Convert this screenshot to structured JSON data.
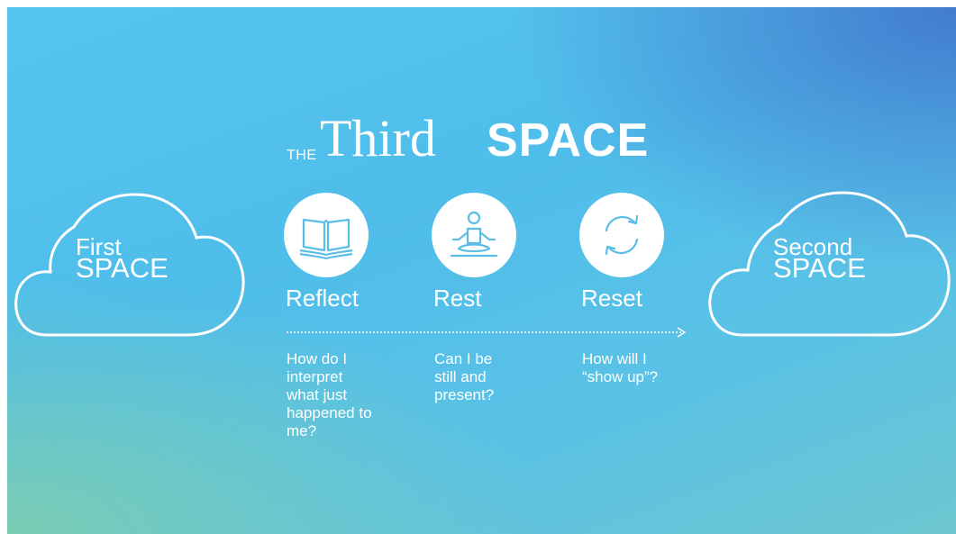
{
  "title": {
    "the": "THE",
    "third": "Third",
    "space": "SPACE"
  },
  "clouds": {
    "first": {
      "line1": "First",
      "line2": "SPACE"
    },
    "second": {
      "line1": "Second",
      "line2": "SPACE"
    }
  },
  "steps": [
    {
      "label": "Reflect",
      "icon": "open-book-icon",
      "question": "How do I\ninterpret\nwhat just\nhappened to\nme?"
    },
    {
      "label": "Rest",
      "icon": "meditation-icon",
      "question": "Can I be\nstill and\npresent?"
    },
    {
      "label": "Reset",
      "icon": "refresh-icon",
      "question": "How will I\n“show up”?"
    }
  ],
  "colors": {
    "text": "#ffffff",
    "icon": "#5bbde6",
    "background_top_right": "#4278cd",
    "background_bottom_left": "#7ccdb0"
  }
}
